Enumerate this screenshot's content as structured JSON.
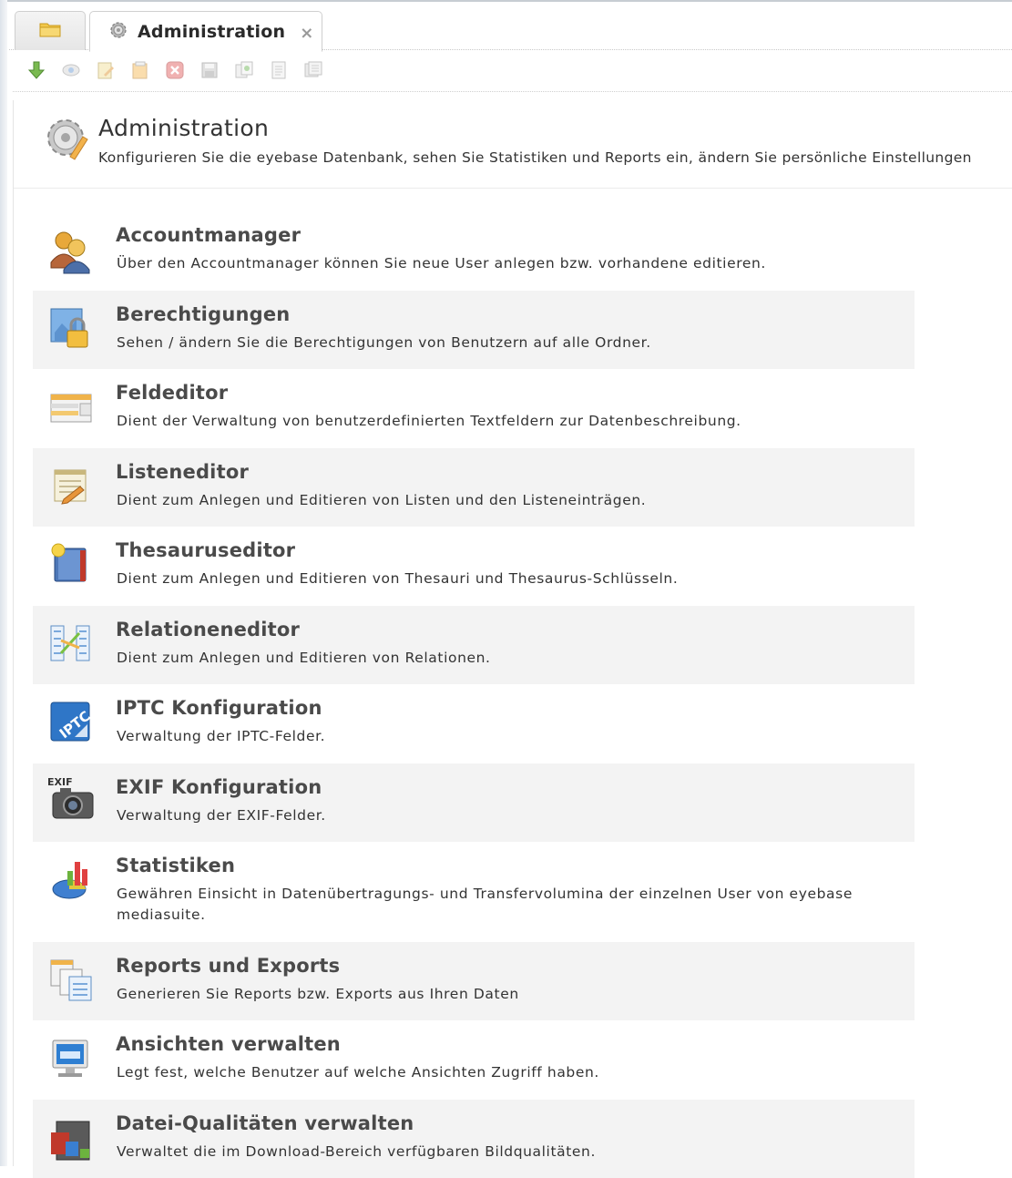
{
  "tab": {
    "title": "Administration",
    "close": "×"
  },
  "header": {
    "title": "Administration",
    "subtitle": "Konfigurieren Sie die eyebase Datenbank, sehen Sie Statistiken und Reports ein, ändern Sie persönliche Einstellungen"
  },
  "toolbar": {
    "icons": [
      "download-icon",
      "view-icon",
      "edit-icon",
      "copy-icon",
      "delete-icon",
      "save-icon",
      "duplicate-icon",
      "document-icon",
      "print-icon"
    ]
  },
  "items": [
    {
      "title": "Accountmanager",
      "desc": "Über den Accountmanager können Sie neue User anlegen bzw. vorhandene editieren.",
      "icon": "users-icon"
    },
    {
      "title": "Berechtigungen",
      "desc": "Sehen / ändern Sie die Berechtigungen von Benutzern auf alle Ordner.",
      "icon": "lock-icon"
    },
    {
      "title": "Feldeditor",
      "desc": "Dient der Verwaltung von benutzerdefinierten Textfeldern zur Datenbeschreibung.",
      "icon": "fields-icon"
    },
    {
      "title": "Listeneditor",
      "desc": "Dient zum Anlegen und Editieren von Listen und den Listeneinträgen.",
      "icon": "list-edit-icon"
    },
    {
      "title": "Thesauruseditor",
      "desc": "Dient zum Anlegen und Editieren von Thesauri und Thesaurus-Schlüsseln.",
      "icon": "book-icon"
    },
    {
      "title": "Relationeneditor",
      "desc": "Dient zum Anlegen und Editieren von Relationen.",
      "icon": "relation-icon"
    },
    {
      "title": "IPTC Konfiguration",
      "desc": "Verwaltung der IPTC-Felder.",
      "icon": "iptc-icon"
    },
    {
      "title": "EXIF Konfiguration",
      "desc": "Verwaltung der EXIF-Felder.",
      "icon": "camera-icon",
      "badge": "EXIF"
    },
    {
      "title": "Statistiken",
      "desc": "Gewähren Einsicht in Datenübertragungs- und Transfervolumina der einzelnen User von eyebase mediasuite.",
      "icon": "stats-icon"
    },
    {
      "title": "Reports und Exports",
      "desc": "Generieren Sie Reports bzw. Exports aus Ihren Daten",
      "icon": "reports-icon"
    },
    {
      "title": "Ansichten verwalten",
      "desc": "Legt fest, welche Benutzer auf welche Ansichten Zugriff haben.",
      "icon": "monitor-icon"
    },
    {
      "title": "Datei-Qualitäten verwalten",
      "desc": "Verwaltet die im Download-Bereich verfügbaren Bildqualitäten.",
      "icon": "quality-icon"
    }
  ]
}
